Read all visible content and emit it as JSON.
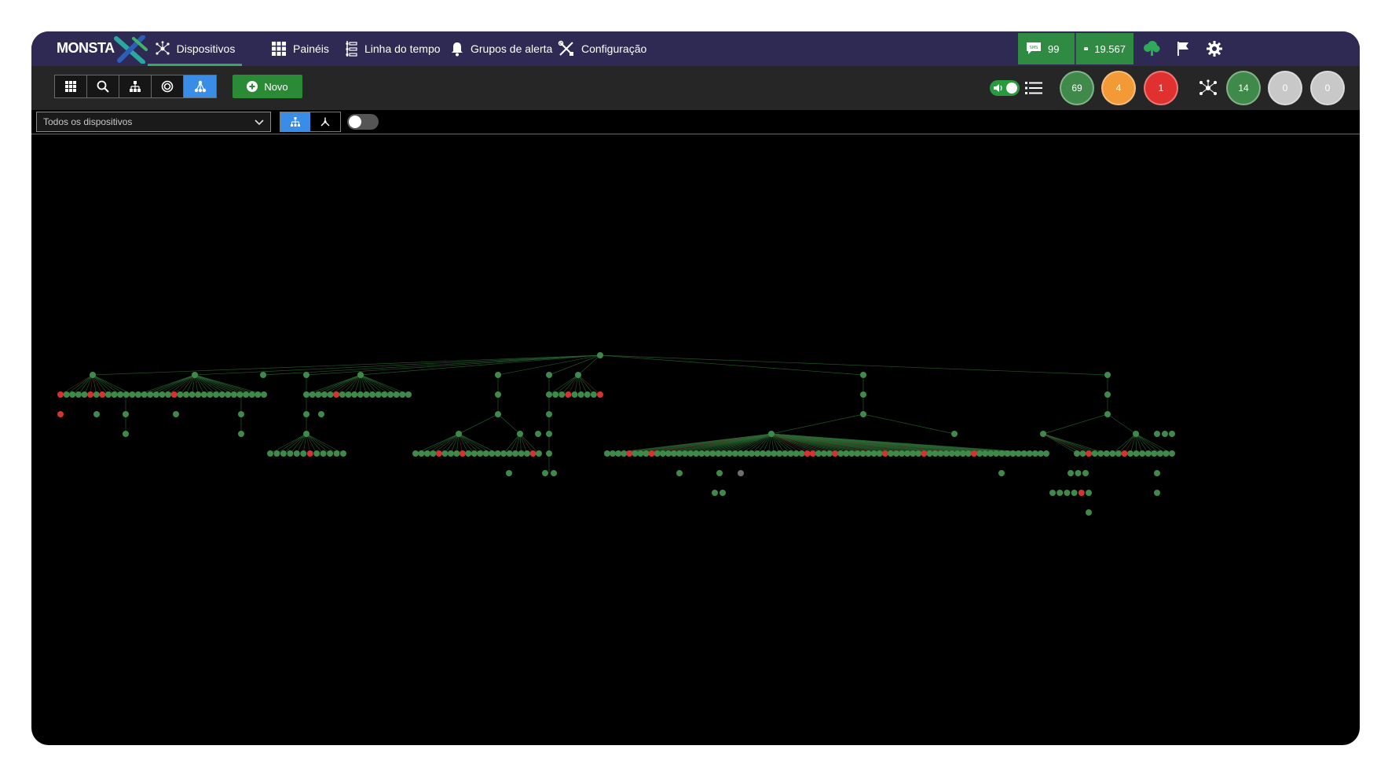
{
  "app": {
    "logo_text": "MONSTA"
  },
  "nav": {
    "items": [
      {
        "label": "Dispositivos",
        "icon": "network-icon",
        "active": true
      },
      {
        "label": "Painéis",
        "icon": "grid-icon",
        "active": false
      },
      {
        "label": "Linha do tempo",
        "icon": "timeline-icon",
        "active": false
      },
      {
        "label": "Grupos de alerta",
        "icon": "bell-icon",
        "active": false
      },
      {
        "label": "Configuração",
        "icon": "tools-icon",
        "active": false
      }
    ],
    "counters": [
      {
        "label": "99",
        "icon": "sms-icon"
      },
      {
        "label": "19.567",
        "icon": "mail-icon"
      }
    ]
  },
  "toolbar": {
    "novo_label": "Novo",
    "status_counts": {
      "ok": "69",
      "warning": "4",
      "error": "1"
    },
    "topology_counts": {
      "ok": "14",
      "unknown_a": "0",
      "unknown_b": "0"
    },
    "colors": {
      "ok": "#3f8a4a",
      "warning": "#f29a36",
      "error": "#e0302f",
      "unknown": "#c8c8c8",
      "accent": "#3a8de6"
    }
  },
  "filter": {
    "selected": "Todos os dispositivos"
  }
}
